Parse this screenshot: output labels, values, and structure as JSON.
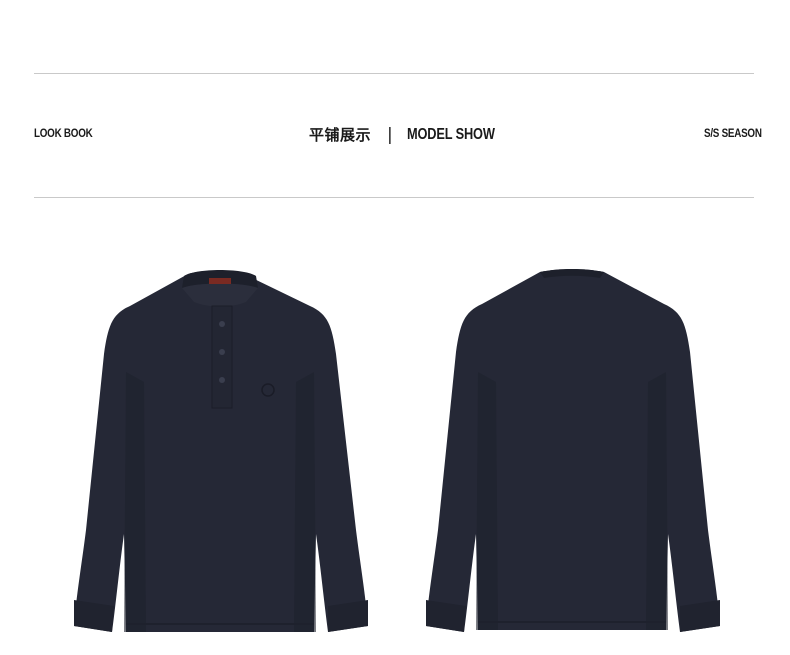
{
  "header": {
    "left_label": "LOOK BOOK",
    "center_cn": "平铺展示",
    "separator": "|",
    "center_en": "MODEL SHOW",
    "right_label": "S/S SEASON"
  },
  "products": [
    {
      "view": "front",
      "icon": "henley-shirt-front",
      "color": "#252836"
    },
    {
      "view": "back",
      "icon": "henley-shirt-back",
      "color": "#252836"
    }
  ]
}
